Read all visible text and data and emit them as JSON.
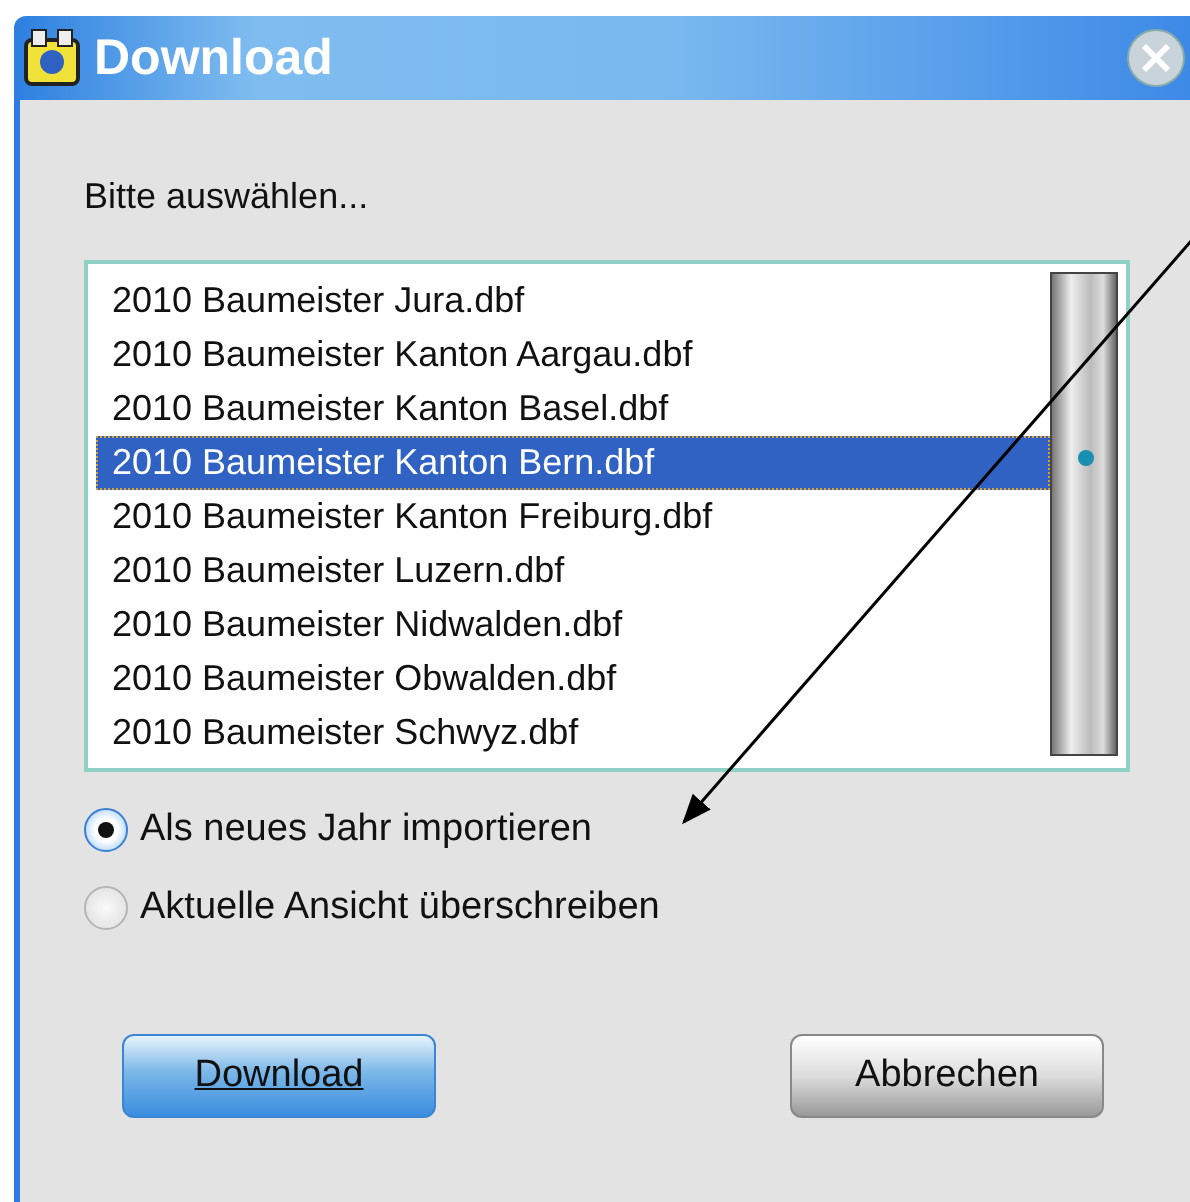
{
  "window": {
    "title": "Download"
  },
  "prompt": "Bitte auswählen...",
  "files": [
    {
      "name": "2010 Baumeister Jura.dbf",
      "selected": false
    },
    {
      "name": "2010 Baumeister Kanton Aargau.dbf",
      "selected": false
    },
    {
      "name": "2010 Baumeister Kanton Basel.dbf",
      "selected": false
    },
    {
      "name": "2010 Baumeister Kanton Bern.dbf",
      "selected": true
    },
    {
      "name": "2010 Baumeister Kanton Freiburg.dbf",
      "selected": false
    },
    {
      "name": "2010 Baumeister Luzern.dbf",
      "selected": false
    },
    {
      "name": "2010 Baumeister Nidwalden.dbf",
      "selected": false
    },
    {
      "name": "2010 Baumeister Obwalden.dbf",
      "selected": false
    },
    {
      "name": "2010 Baumeister Schwyz.dbf",
      "selected": false
    }
  ],
  "options": [
    {
      "label": "Als neues Jahr importieren",
      "selected": true
    },
    {
      "label": "Aktuelle Ansicht überschreiben",
      "selected": false
    }
  ],
  "buttons": [
    {
      "label": "Download",
      "kind": "default"
    },
    {
      "label": "Abbrechen",
      "kind": "normal"
    }
  ]
}
